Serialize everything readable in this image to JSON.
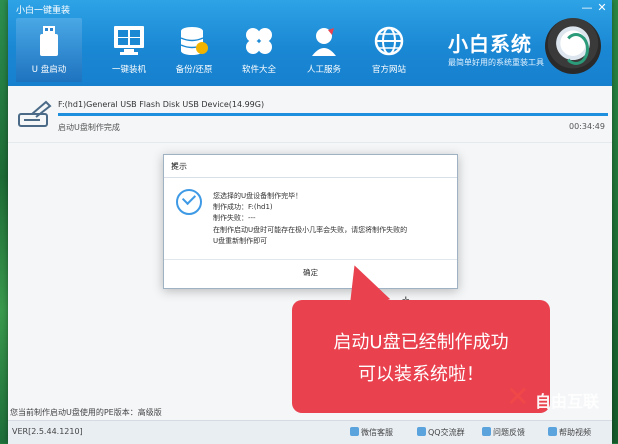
{
  "window": {
    "title": "小白一键重装",
    "controls": [
      "—",
      "✕"
    ]
  },
  "nav": [
    {
      "label": "U 盘启动",
      "icon": "usb-icon",
      "active": true
    },
    {
      "label": "一键装机",
      "icon": "windows-icon",
      "active": false
    },
    {
      "label": "备份/还原",
      "icon": "database-icon",
      "active": false
    },
    {
      "label": "软件大全",
      "icon": "apps-icon",
      "active": false
    },
    {
      "label": "人工服务",
      "icon": "support-icon",
      "active": false
    },
    {
      "label": "官方网站",
      "icon": "globe-icon",
      "active": false
    }
  ],
  "brand": {
    "name": "小白系统",
    "slogan": "最简单好用的系统重装工具"
  },
  "device": {
    "name": "F:(hd1)General USB Flash Disk USB Device(14.99G)",
    "status": "启动U盘制作完成",
    "elapsed": "00:34:49",
    "progress": 1.0
  },
  "dialog": {
    "title": "提示",
    "lines": [
      "您选择的U盘设备制作完毕！",
      "制作成功：F:(hd1)",
      "制作失败：---",
      "在制作启动U盘时可能存在极小几率会失败，请您将制作失败的",
      "U盘重新制作即可"
    ],
    "ok_label": "确定"
  },
  "callout": {
    "line1": "启动U盘已经制作成功",
    "line2": "可以装系统啦！"
  },
  "footer": {
    "pe_info": "您当前制作启动U盘使用的PE版本：高级版",
    "version": "VER[2.5.44.1210]",
    "links": [
      "微信客服",
      "QQ交流群",
      "问题反馈",
      "帮助视频"
    ]
  },
  "watermark": "自由互联",
  "colors": {
    "header": "#1b88d4",
    "accent": "#1e8fdc",
    "callout": "#e9414e"
  }
}
